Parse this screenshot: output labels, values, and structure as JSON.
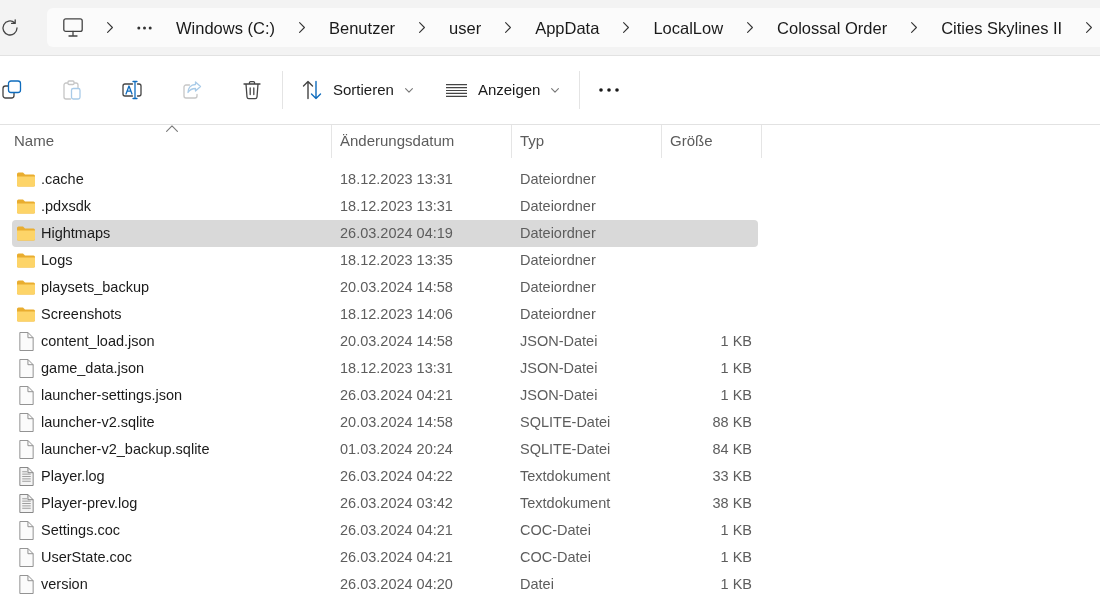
{
  "address_bar": {
    "segments": [
      "Windows (C:)",
      "Benutzer",
      "user",
      "AppData",
      "LocalLow",
      "Colossal Order",
      "Cities Skylines II"
    ]
  },
  "toolbar": {
    "actions": [
      {
        "kind": "copy",
        "disabled": false
      },
      {
        "kind": "paste",
        "disabled": true
      },
      {
        "kind": "rename",
        "disabled": false
      },
      {
        "kind": "share",
        "disabled": true
      },
      {
        "kind": "delete",
        "disabled": false
      }
    ],
    "menus": [
      {
        "kind": "sort",
        "label": "Sortieren"
      },
      {
        "kind": "view",
        "label": "Anzeigen"
      }
    ]
  },
  "table": {
    "columns": [
      {
        "label": "Name",
        "sorted": true
      },
      {
        "label": "Änderungsdatum",
        "sorted": false
      },
      {
        "label": "Typ",
        "sorted": false
      },
      {
        "label": "Größe",
        "sorted": false
      }
    ],
    "rows": [
      {
        "kind": "folder",
        "name": ".cache",
        "modified": "18.12.2023 13:31",
        "type": "Dateiordner",
        "selected": false
      },
      {
        "kind": "folder",
        "name": ".pdxsdk",
        "modified": "18.12.2023 13:31",
        "type": "Dateiordner",
        "selected": false
      },
      {
        "kind": "folder",
        "name": "Hightmaps",
        "modified": "26.03.2024 04:19",
        "type": "Dateiordner",
        "selected": true
      },
      {
        "kind": "folder",
        "name": "Logs",
        "modified": "18.12.2023 13:35",
        "type": "Dateiordner",
        "selected": false
      },
      {
        "kind": "folder",
        "name": "playsets_backup",
        "modified": "20.03.2024 14:58",
        "type": "Dateiordner",
        "selected": false
      },
      {
        "kind": "folder",
        "name": "Screenshots",
        "modified": "18.12.2023 14:06",
        "type": "Dateiordner",
        "selected": false
      },
      {
        "kind": "file",
        "name": "content_load.json",
        "modified": "20.03.2024 14:58",
        "type": "JSON-Datei",
        "size": "1 KB",
        "selected": false
      },
      {
        "kind": "file",
        "name": "game_data.json",
        "modified": "18.12.2023 13:31",
        "type": "JSON-Datei",
        "size": "1 KB",
        "selected": false
      },
      {
        "kind": "file",
        "name": "launcher-settings.json",
        "modified": "26.03.2024 04:21",
        "type": "JSON-Datei",
        "size": "1 KB",
        "selected": false
      },
      {
        "kind": "file",
        "name": "launcher-v2.sqlite",
        "modified": "20.03.2024 14:58",
        "type": "SQLITE-Datei",
        "size": "88 KB",
        "selected": false
      },
      {
        "kind": "file",
        "name": "launcher-v2_backup.sqlite",
        "modified": "01.03.2024 20:24",
        "type": "SQLITE-Datei",
        "size": "84 KB",
        "selected": false
      },
      {
        "kind": "text",
        "name": "Player.log",
        "modified": "26.03.2024 04:22",
        "type": "Textdokument",
        "size": "33 KB",
        "selected": false
      },
      {
        "kind": "text",
        "name": "Player-prev.log",
        "modified": "26.03.2024 03:42",
        "type": "Textdokument",
        "size": "38 KB",
        "selected": false
      },
      {
        "kind": "file",
        "name": "Settings.coc",
        "modified": "26.03.2024 04:21",
        "type": "COC-Datei",
        "size": "1 KB",
        "selected": false
      },
      {
        "kind": "file",
        "name": "UserState.coc",
        "modified": "26.03.2024 04:21",
        "type": "COC-Datei",
        "size": "1 KB",
        "selected": false
      },
      {
        "kind": "file",
        "name": "version",
        "modified": "26.03.2024 04:20",
        "type": "Datei",
        "size": "1 KB",
        "selected": false
      }
    ]
  }
}
